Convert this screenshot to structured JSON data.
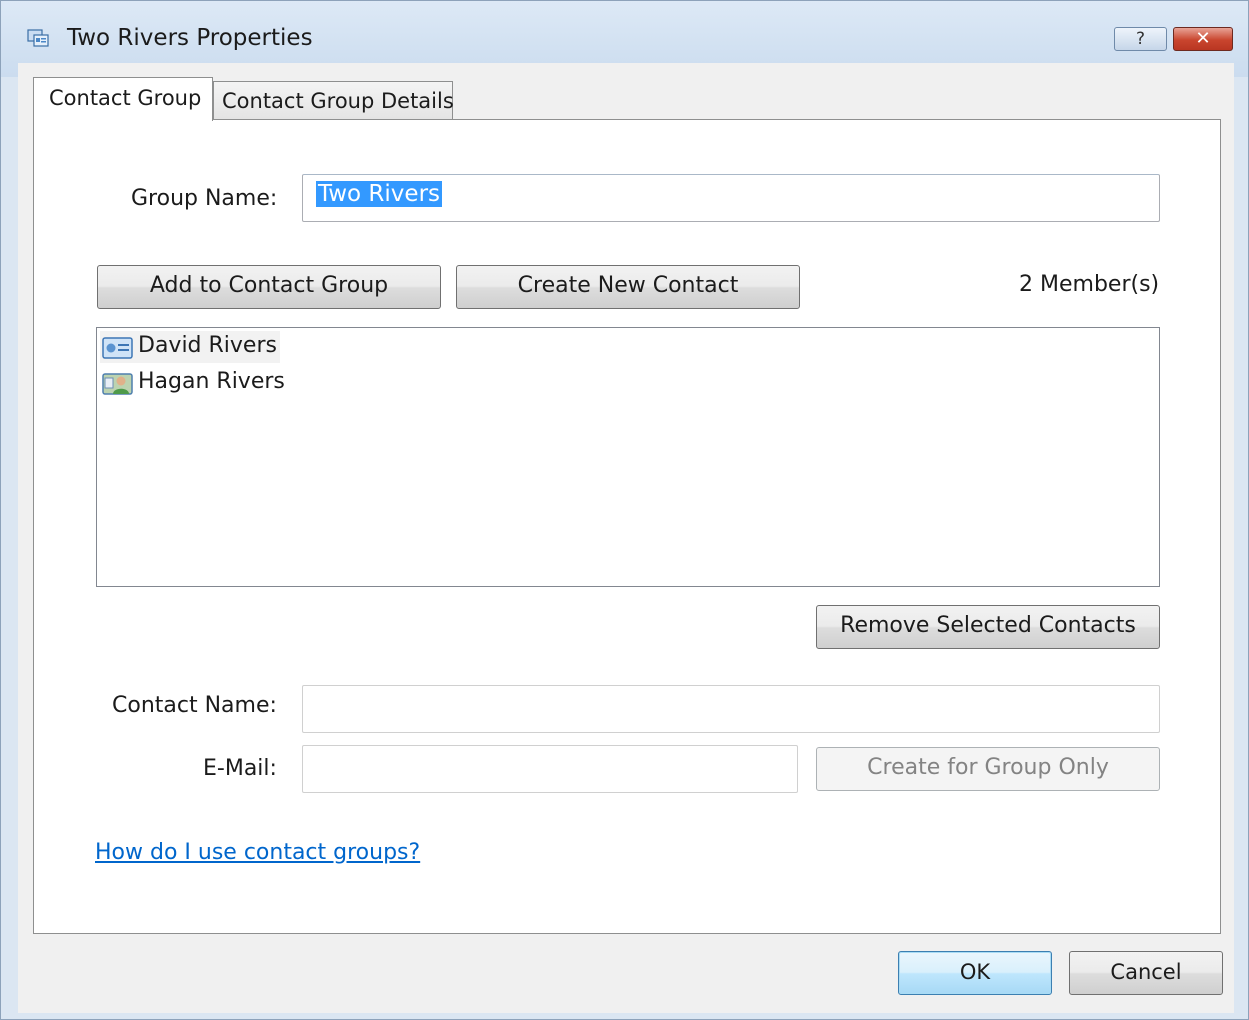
{
  "window": {
    "title": "Two Rivers Properties",
    "help_glyph": "?",
    "close_glyph": "✕"
  },
  "tabs": [
    {
      "label": "Contact Group",
      "selected": true
    },
    {
      "label": "Contact Group Details",
      "selected": false
    }
  ],
  "form": {
    "group_name_label": "Group Name:",
    "group_name_value": "Two Rivers",
    "add_button": "Add to Contact Group",
    "create_button": "Create New Contact",
    "member_count": "2 Member(s)",
    "members": [
      {
        "name": "David Rivers",
        "icon": "contact-card-icon"
      },
      {
        "name": "Hagan Rivers",
        "icon": "contact-photo-icon"
      }
    ],
    "remove_button": "Remove Selected Contacts",
    "contact_name_label": "Contact Name:",
    "contact_name_value": "",
    "email_label": "E-Mail:",
    "email_value": "",
    "create_group_only_button": "Create for Group Only",
    "help_link": "How do I use contact groups?"
  },
  "footer": {
    "ok_button": "OK",
    "cancel_button": "Cancel"
  },
  "colors": {
    "selection": "#3399ff",
    "link": "#0066cc",
    "close_button": "#c9452e",
    "title_bar": "#cbdcef"
  }
}
